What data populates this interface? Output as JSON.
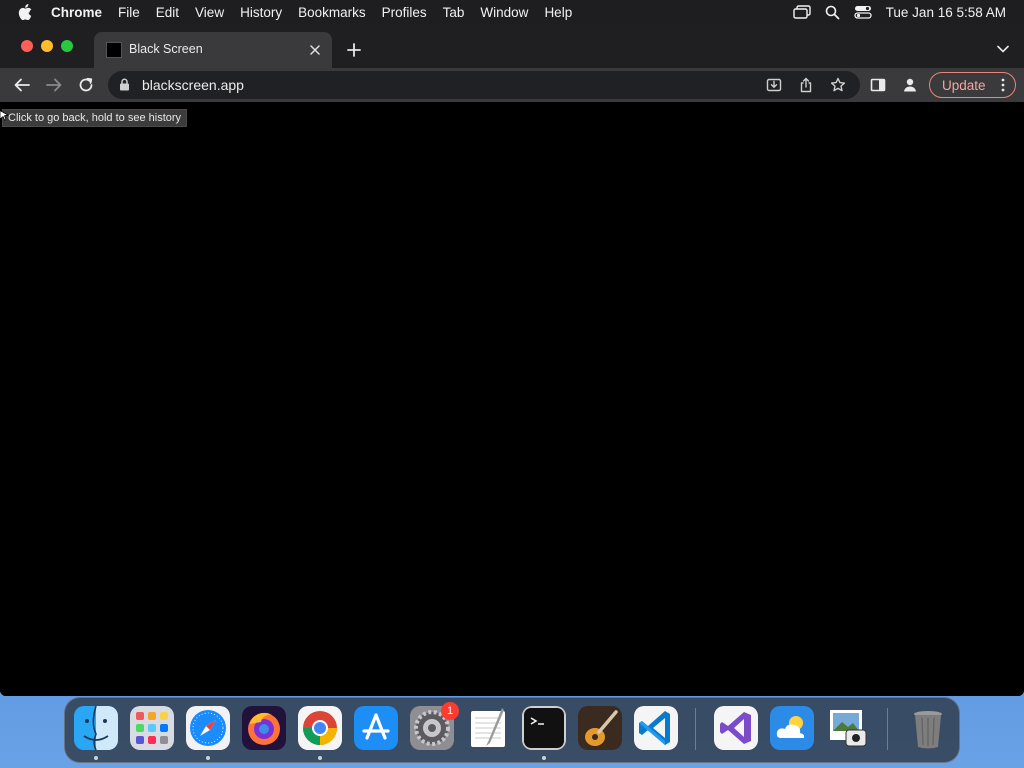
{
  "menubar": {
    "app_name": "Chrome",
    "items": [
      "File",
      "Edit",
      "View",
      "History",
      "Bookmarks",
      "Profiles",
      "Tab",
      "Window",
      "Help"
    ],
    "clock": "Tue Jan 16  5:58 AM"
  },
  "browser": {
    "tab": {
      "title": "Black Screen"
    },
    "address": {
      "url": "blackscreen.app"
    },
    "update_label": "Update",
    "tooltip": "Click to go back, hold to see history"
  },
  "dock": {
    "apps": [
      "Finder",
      "Launchpad",
      "Safari",
      "Firefox",
      "Google Chrome",
      "App Store",
      "System Settings",
      "TextEdit",
      "Terminal",
      "GarageBand",
      "Visual Studio Code",
      "Visual Studio",
      "Weather",
      "Preview",
      "Trash"
    ],
    "settings_badge": "1"
  },
  "colors": {
    "page_background": "#000000",
    "update_accent": "#e8867c",
    "close": "#ff5f57",
    "minimize": "#febc2e",
    "maximize": "#28c840"
  }
}
